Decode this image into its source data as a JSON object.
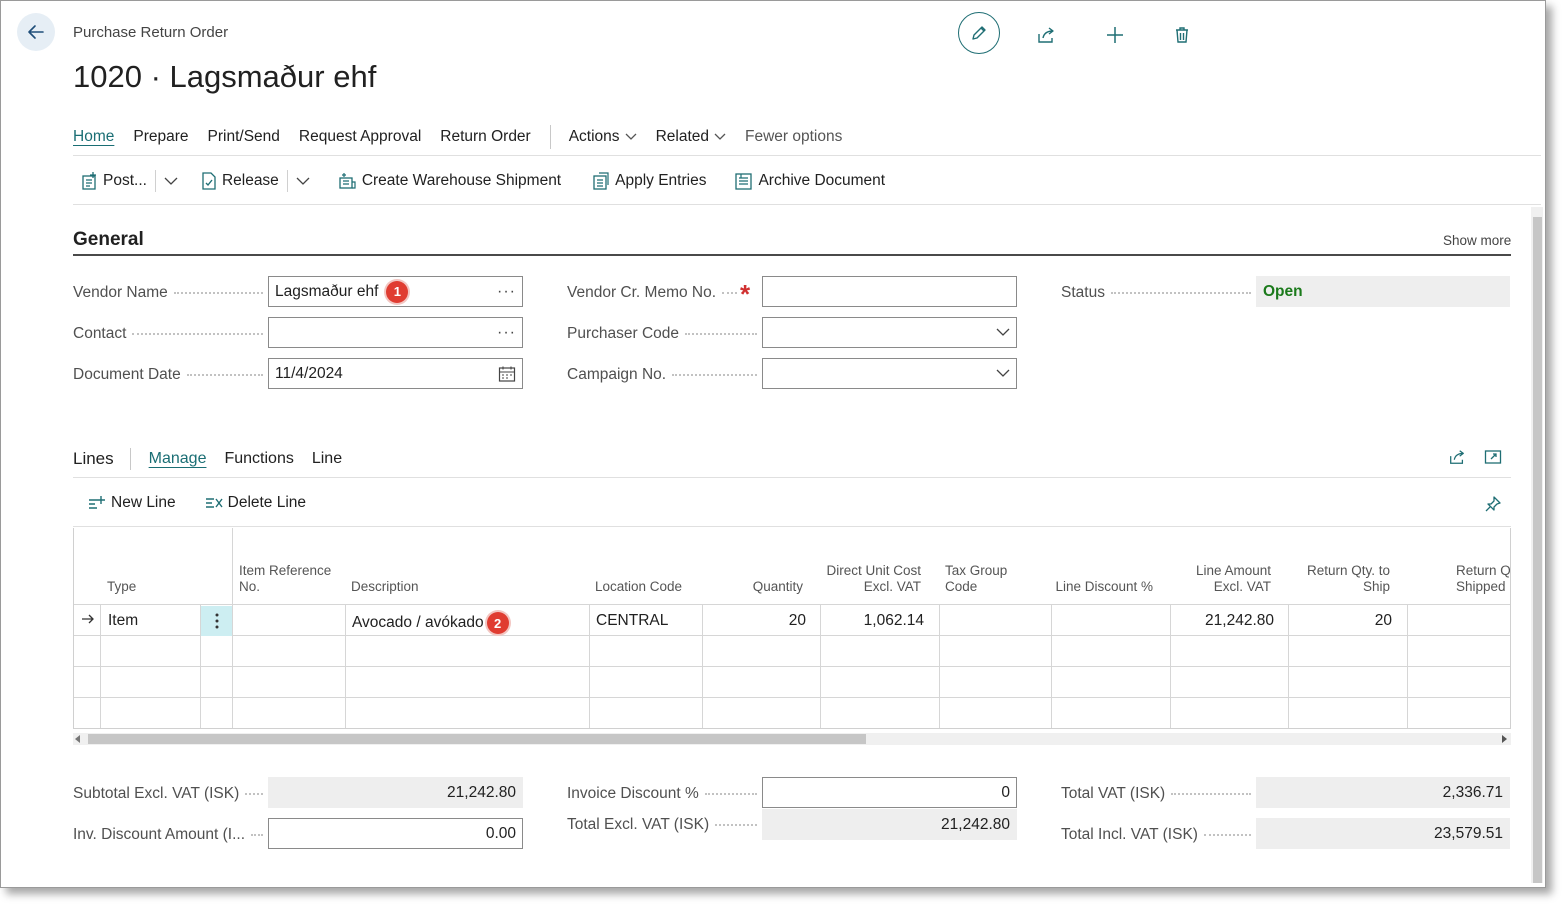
{
  "header": {
    "breadcrumb": "Purchase Return Order",
    "title": "1020 · Lagsmaður ehf"
  },
  "tabs": [
    {
      "label": "Home",
      "active": true
    },
    {
      "label": "Prepare"
    },
    {
      "label": "Print/Send"
    },
    {
      "label": "Request Approval"
    },
    {
      "label": "Return Order"
    },
    {
      "label": "Actions"
    },
    {
      "label": "Related"
    },
    {
      "label": "Fewer options"
    }
  ],
  "actions": {
    "post": "Post...",
    "release": "Release",
    "create_shipment": "Create Warehouse Shipment",
    "apply_entries": "Apply Entries",
    "archive": "Archive Document"
  },
  "general": {
    "title": "General",
    "show_more": "Show more",
    "vendor_name_label": "Vendor Name",
    "vendor_name_value": "Lagsmaður ehf",
    "contact_label": "Contact",
    "contact_value": "",
    "document_date_label": "Document Date",
    "document_date_value": "11/4/2024",
    "vendor_cr_memo_label": "Vendor Cr. Memo No.",
    "vendor_cr_memo_value": "",
    "purchaser_code_label": "Purchaser Code",
    "purchaser_code_value": "",
    "campaign_no_label": "Campaign No.",
    "campaign_no_value": "",
    "status_label": "Status",
    "status_value": "Open"
  },
  "badges": [
    "1",
    "2"
  ],
  "lines": {
    "title": "Lines",
    "tabs": [
      "Manage",
      "Functions",
      "Line"
    ],
    "new_line": "New Line",
    "delete_line": "Delete Line",
    "columns": {
      "type": "Type",
      "item_ref": "Item Reference No.",
      "description": "Description",
      "location": "Location Code",
      "quantity": "Quantity",
      "unit_cost": "Direct Unit Cost Excl. VAT",
      "tax_group": "Tax Group Code",
      "line_discount": "Line Discount %",
      "line_amount": "Line Amount Excl. VAT",
      "return_qty_ship": "Return Qty. to Ship",
      "return_qty_shipped": "Return Qty. Shipped"
    },
    "rows": [
      {
        "type": "Item",
        "item_ref": "",
        "description": "Avocado / avókado",
        "location": "CENTRAL",
        "quantity": "20",
        "unit_cost": "1,062.14",
        "tax_group": "",
        "line_discount": "",
        "line_amount": "21,242.80",
        "return_qty_ship": "20"
      }
    ]
  },
  "totals": {
    "subtotal_label": "Subtotal Excl. VAT (ISK)",
    "subtotal_value": "21,242.80",
    "inv_discount_amount_label": "Inv. Discount Amount (I...",
    "inv_discount_amount_value": "0.00",
    "invoice_discount_pct_label": "Invoice Discount %",
    "invoice_discount_pct_value": "0",
    "total_excl_label": "Total Excl. VAT (ISK)",
    "total_excl_value": "21,242.80",
    "total_vat_label": "Total VAT (ISK)",
    "total_vat_value": "2,336.71",
    "total_incl_label": "Total Incl. VAT (ISK)",
    "total_incl_value": "23,579.51"
  },
  "colors": {
    "accent": "#1a6e74",
    "status_open": "#1b7a1b",
    "badge": "#e03c31",
    "required": "#d03030"
  }
}
